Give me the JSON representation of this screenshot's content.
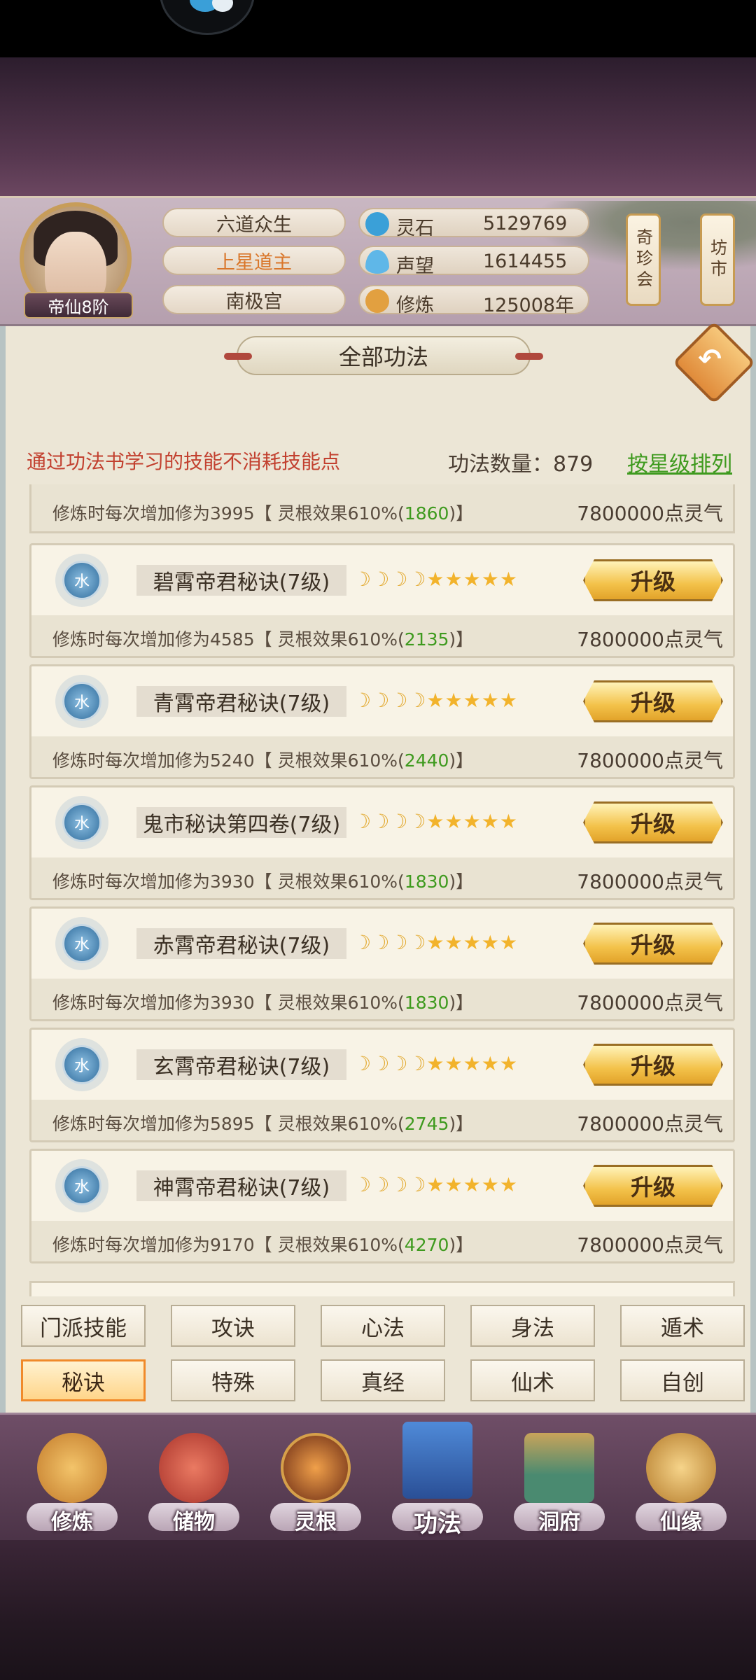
{
  "header": {
    "rank_badge": "帝仙8阶",
    "info": [
      "六道众生",
      "上星道主",
      "南极宫"
    ],
    "resources": [
      {
        "label": "灵石",
        "value": "5129769",
        "icon": "spirit-stone-icon",
        "color": "#3aa0d8"
      },
      {
        "label": "声望",
        "value": "1614455",
        "icon": "reputation-flame-icon",
        "color": "#5fb7e8"
      },
      {
        "label": "修炼",
        "value": "125008年",
        "icon": "meditation-icon",
        "color": "#e2a040"
      }
    ],
    "side_buttons": [
      "奇珍会",
      "坊市"
    ]
  },
  "panel": {
    "title": "全部功法",
    "notice": "通过功法书学习的技能不消耗技能点",
    "count": "功法数量：879",
    "sort_label": "按星级排列"
  },
  "partial_item": {
    "desc": "修炼时每次增加修为3995【 灵根效果610%(",
    "bonus": "1860",
    "desc_end": ")】",
    "cost": "7800000点灵气"
  },
  "skills": [
    {
      "element": "水",
      "name": "碧霄帝君秘诀(7级)",
      "stars": "🌙🌙🌙🌙★★★★★",
      "upgrade": "升级",
      "desc": "修炼时每次增加修为4585【 灵根效果610%(",
      "bonus": "2135",
      "desc_end": ")】",
      "cost": "7800000点灵气"
    },
    {
      "element": "水",
      "name": "青霄帝君秘诀(7级)",
      "stars": "🌙🌙🌙🌙★★★★★",
      "upgrade": "升级",
      "desc": "修炼时每次增加修为5240【 灵根效果610%(",
      "bonus": "2440",
      "desc_end": ")】",
      "cost": "7800000点灵气"
    },
    {
      "element": "水",
      "name": "鬼市秘诀第四卷(7级)",
      "stars": "🌙🌙🌙🌙★★★★★",
      "upgrade": "升级",
      "desc": "修炼时每次增加修为3930【 灵根效果610%(",
      "bonus": "1830",
      "desc_end": ")】",
      "cost": "7800000点灵气"
    },
    {
      "element": "水",
      "name": "赤霄帝君秘诀(7级)",
      "stars": "🌙🌙🌙🌙★★★★★",
      "upgrade": "升级",
      "desc": "修炼时每次增加修为3930【 灵根效果610%(",
      "bonus": "1830",
      "desc_end": ")】",
      "cost": "7800000点灵气"
    },
    {
      "element": "水",
      "name": "玄霄帝君秘诀(7级)",
      "stars": "🌙🌙🌙🌙★★★★★",
      "upgrade": "升级",
      "desc": "修炼时每次增加修为5895【 灵根效果610%(",
      "bonus": "2745",
      "desc_end": ")】",
      "cost": "7800000点灵气"
    },
    {
      "element": "水",
      "name": "神霄帝君秘诀(7级)",
      "stars": "🌙🌙🌙🌙★★★★★",
      "upgrade": "升级",
      "desc": "修炼时每次增加修为9170【 灵根效果610%(",
      "bonus": "4270",
      "desc_end": ")】",
      "cost": "7800000点灵气"
    }
  ],
  "category_tabs": [
    {
      "label": "门派技能",
      "active": false
    },
    {
      "label": "攻诀",
      "active": false
    },
    {
      "label": "心法",
      "active": false
    },
    {
      "label": "身法",
      "active": false
    },
    {
      "label": "遁术",
      "active": false
    },
    {
      "label": "秘诀",
      "active": true
    },
    {
      "label": "特殊",
      "active": false
    },
    {
      "label": "真经",
      "active": false
    },
    {
      "label": "仙术",
      "active": false
    },
    {
      "label": "自创",
      "active": false
    }
  ],
  "bottom_nav": [
    {
      "label": "修炼",
      "icon": "cultivate-icon",
      "color": "#e0a040",
      "active": false
    },
    {
      "label": "储物",
      "icon": "storage-bag-icon",
      "color": "#d04a3a",
      "active": false
    },
    {
      "label": "灵根",
      "icon": "spirit-root-icon",
      "color": "#c2662a",
      "active": false
    },
    {
      "label": "功法",
      "icon": "skill-book-icon",
      "color": "#3a6fc0",
      "active": true
    },
    {
      "label": "洞府",
      "icon": "cave-house-icon",
      "color": "#4a8a70",
      "active": false
    },
    {
      "label": "仙缘",
      "icon": "fortune-gourd-icon",
      "color": "#e0b060",
      "active": false
    }
  ]
}
